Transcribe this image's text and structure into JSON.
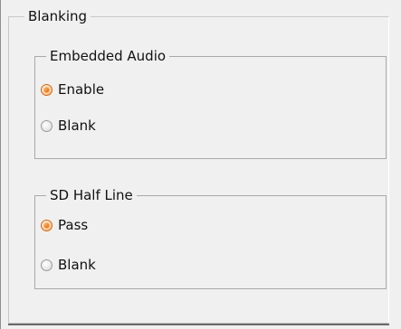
{
  "title": "Blanking",
  "groups": [
    {
      "label": "Embedded Audio",
      "options": [
        {
          "label": "Enable",
          "checked": true
        },
        {
          "label": "Blank",
          "checked": false
        }
      ]
    },
    {
      "label": "SD Half Line",
      "options": [
        {
          "label": "Pass",
          "checked": true
        },
        {
          "label": "Blank",
          "checked": false
        }
      ]
    }
  ],
  "colors": {
    "background": "#f0f0f0",
    "border": "#a9a9a9",
    "radio_selected": "#e36a00"
  }
}
